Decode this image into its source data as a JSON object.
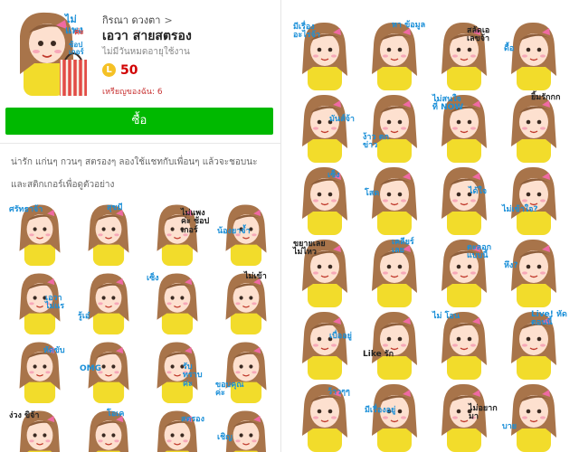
{
  "product": {
    "creator": "กิรณา ดวงตา",
    "creator_chevron": ">",
    "title": "เอวา สายสตรอง",
    "subtitle": "ไม่มีวันหมดอายุใช้งาน",
    "coin_symbol": "L",
    "price": "50",
    "coins_note": "เหรียญของฉัน: 6",
    "buy_label": "ซื้อ",
    "description_line1": "น่ารัก แก่นๆ กวนๆ สตรองๆ ลองใช้แชทกับเพื่อนๆ แล้วจะชอบนะ",
    "description_line2": "และสติกเกอร์เพื่อดูตัวอย่าง",
    "thumb_caption": [
      "ไม่แพง",
      "ค่ะ",
      "ช้อปเกอร์"
    ]
  },
  "colors": {
    "buy_green": "#00b900",
    "price_red": "#d10000",
    "coin_yellow": "#f5c125",
    "caption_blue": "#1a8fd8",
    "hair_brown": "#a8744a",
    "shirt_yellow": "#f2dc2b"
  },
  "left_stickers": [
    {
      "caption": "ศรัทธาจ้า"
    },
    {
      "caption": "สุขมี"
    },
    {
      "caption": "ไม่แพง ค่ะ ช้อปเกอร์"
    },
    {
      "caption": "น้องยาจ้ำ"
    },
    {
      "caption": "เอวา ไม่แร"
    },
    {
      "caption": "รู้เอ๋"
    },
    {
      "caption": "เซ็ง"
    },
    {
      "caption": "ไม่เข้า"
    },
    {
      "caption": "หัดขับ"
    },
    {
      "caption": "OMG"
    },
    {
      "caption": "รับทราบค่ะ"
    },
    {
      "caption": "ขอบคุณค่ะ"
    },
    {
      "caption": "ง่วง ขิจ้า"
    },
    {
      "caption": "โอเค"
    },
    {
      "caption": "สตรอง"
    },
    {
      "caption": "เชิญ"
    }
  ],
  "right_stickers": [
    {
      "caption": "มีเรื่องอะไรจ้า"
    },
    {
      "caption": "หา ข้อมูล"
    },
    {
      "caption": "สลัดเอ เลขจ้า"
    },
    {
      "caption": "ดื้อ"
    },
    {
      "caption": "มันส์จ้า"
    },
    {
      "caption": "ง้าว ตก ข่าว"
    },
    {
      "caption": "ไม่สนใจ ที่ NOW"
    },
    {
      "caption": "ยิ้มรักกก"
    },
    {
      "caption": "เซ็ง"
    },
    {
      "caption": "โสด"
    },
    {
      "caption": "ได้ใจ"
    },
    {
      "caption": "ไม่เข้าใจ?"
    },
    {
      "caption": "ขยายเลยไม่ไหว"
    },
    {
      "caption": "เคลียร์ เลย"
    },
    {
      "caption": "ตะลอก แบบนี้"
    },
    {
      "caption": "หึง?"
    },
    {
      "caption": "เบื่ออยู่"
    },
    {
      "caption": "Like รัก"
    },
    {
      "caption": "ไม่ โอน"
    },
    {
      "caption": "Live! หัด ตอนนี้"
    },
    {
      "caption": "ว้าวๆๆ"
    },
    {
      "caption": "มีเรื่องอยู่"
    },
    {
      "caption": "ไม่อยากมา"
    },
    {
      "caption": "บาย"
    }
  ]
}
